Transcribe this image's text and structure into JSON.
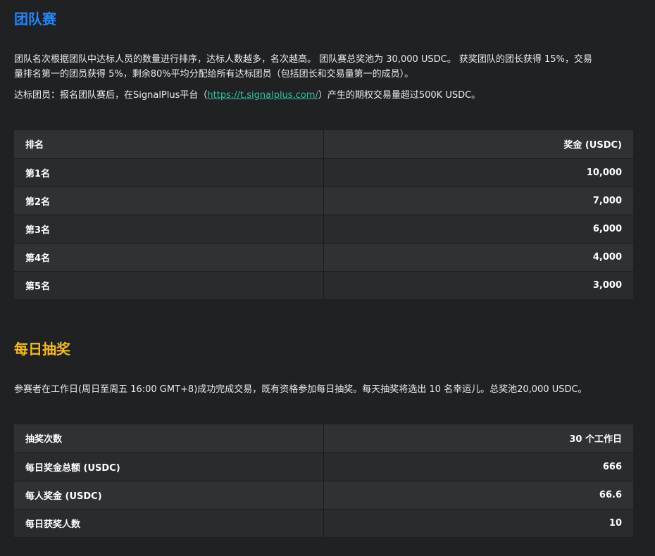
{
  "team": {
    "title": "团队赛",
    "desc_line1": "团队名次根据团队中达标人员的数量进行排序，达标人数越多，名次越高。 团队赛总奖池为 30,000 USDC。 获奖团队的团长获得 15%，交易",
    "desc_line2": "量排名第一的团员获得 5%，剩余80%平均分配给所有达标团员（包括团长和交易量第一的成员）。",
    "qual_prefix": "达标团员：报名团队赛后，在SignalPlus平台（",
    "qual_link": "https://t.signalplus.com/",
    "qual_suffix": "）产生的期权交易量超过500K USDC。",
    "table": {
      "headers": [
        "排名",
        "奖金 (USDC)"
      ],
      "rows": [
        [
          "第1名",
          "10,000"
        ],
        [
          "第2名",
          "7,000"
        ],
        [
          "第3名",
          "6,000"
        ],
        [
          "第4名",
          "4,000"
        ],
        [
          "第5名",
          "3,000"
        ]
      ]
    }
  },
  "lottery": {
    "title": "每日抽奖",
    "desc": "参赛者在工作日(周日至周五 16:00 GMT+8)成功完成交易，既有资格参加每日抽奖。每天抽奖将选出 10 名幸运儿。总奖池20,000 USDC。",
    "table": {
      "headers": [
        "抽奖次数",
        "30 个工作日"
      ],
      "rows": [
        [
          "每日奖金总额 (USDC)",
          "666"
        ],
        [
          "每人奖金 (USDC)",
          "66.6"
        ],
        [
          "每日获奖人数",
          "10"
        ]
      ]
    }
  },
  "colors": {
    "background": "#202123",
    "team_title": "#1e88ff",
    "lottery_title": "#f5b91a",
    "link": "#2fc3a4",
    "table_header": "#2f3134",
    "table_row_a": "#2a2b2e",
    "table_row_b": "#2f3134"
  }
}
